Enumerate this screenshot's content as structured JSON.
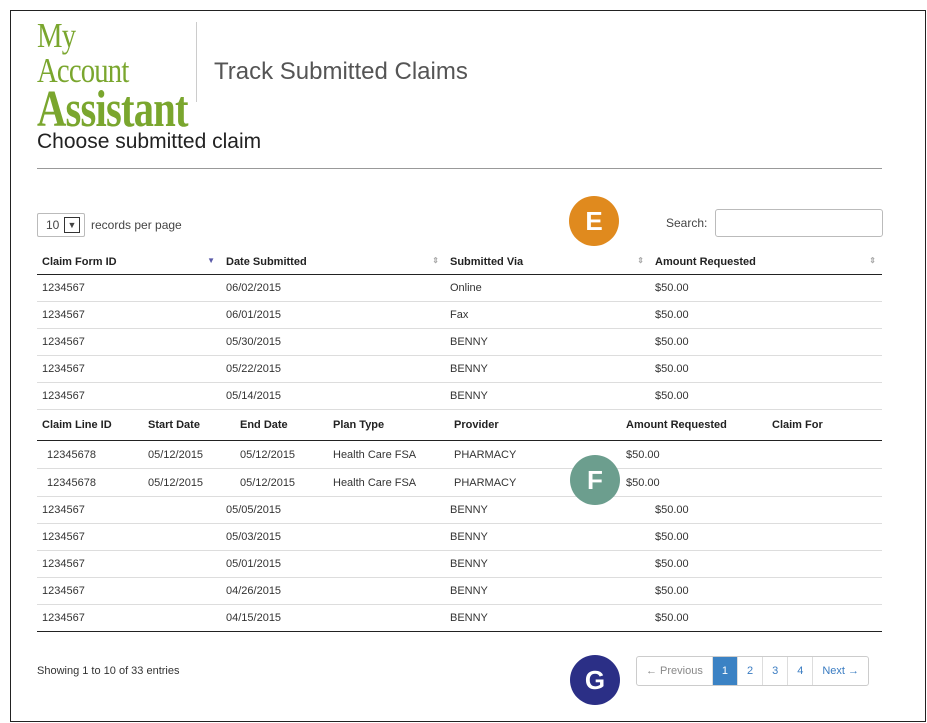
{
  "header": {
    "logo_line1": "My Account",
    "logo_line2": "Assistant",
    "page_title": "Track Submitted Claims"
  },
  "section_title": "Choose submitted claim",
  "length": {
    "value": "10",
    "label": "records per page"
  },
  "search": {
    "label": "Search:",
    "value": "",
    "placeholder": ""
  },
  "badges": {
    "e": "E",
    "f": "F",
    "g": "G"
  },
  "columns": [
    "Claim Form ID",
    "Date Submitted",
    "Submitted Via",
    "Amount Requested"
  ],
  "rows_top": [
    {
      "id": "1234567",
      "date": "06/02/2015",
      "via": "Online",
      "amount": "$50.00"
    },
    {
      "id": "1234567",
      "date": "06/01/2015",
      "via": "Fax",
      "amount": "$50.00"
    },
    {
      "id": "1234567",
      "date": "05/30/2015",
      "via": "BENNY",
      "amount": "$50.00"
    },
    {
      "id": "1234567",
      "date": "05/22/2015",
      "via": "BENNY",
      "amount": "$50.00"
    },
    {
      "id": "1234567",
      "date": "05/14/2015",
      "via": "BENNY",
      "amount": "$50.00"
    }
  ],
  "sub_columns": [
    "Claim Line ID",
    "Start Date",
    "End Date",
    "Plan Type",
    "Provider",
    "Amount Requested",
    "Claim For"
  ],
  "sub_rows": [
    {
      "line": "12345678",
      "start": "05/12/2015",
      "end": "05/12/2015",
      "plan": "Health Care FSA",
      "provider": "PHARMACY",
      "amount": "$50.00",
      "for": ""
    },
    {
      "line": "12345678",
      "start": "05/12/2015",
      "end": "05/12/2015",
      "plan": "Health Care FSA",
      "provider": "PHARMACY",
      "amount": "$50.00",
      "for": ""
    }
  ],
  "rows_bottom": [
    {
      "id": "1234567",
      "date": "05/05/2015",
      "via": "BENNY",
      "amount": "$50.00"
    },
    {
      "id": "1234567",
      "date": "05/03/2015",
      "via": "BENNY",
      "amount": "$50.00"
    },
    {
      "id": "1234567",
      "date": "05/01/2015",
      "via": "BENNY",
      "amount": "$50.00"
    },
    {
      "id": "1234567",
      "date": "04/26/2015",
      "via": "BENNY",
      "amount": "$50.00"
    },
    {
      "id": "1234567",
      "date": "04/15/2015",
      "via": "BENNY",
      "amount": "$50.00"
    }
  ],
  "info": "Showing 1 to 10 of 33 entries",
  "pagination": {
    "prev": "← Previous",
    "pages": [
      "1",
      "2",
      "3",
      "4"
    ],
    "next": "Next →"
  },
  "colors": {
    "logo_green": "#7aa62e",
    "badge_e": "#e08a1e",
    "badge_f": "#6c9e8e",
    "badge_g": "#2b2f86",
    "active_page": "#3b82c4"
  }
}
